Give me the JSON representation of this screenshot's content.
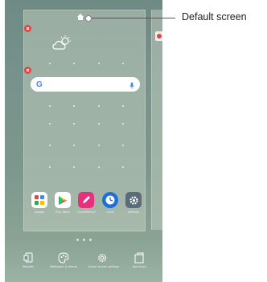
{
  "callout": {
    "label": "Default screen"
  },
  "search": {
    "logo": "G",
    "mic_icon": "mic-icon"
  },
  "weather": {
    "icon": "cloud-sun-icon"
  },
  "apps": [
    {
      "label": "Google",
      "icon": "google-folder-icon",
      "color": "#ffffff"
    },
    {
      "label": "Play Store",
      "icon": "play-store-icon",
      "color": "#ffffff"
    },
    {
      "label": "QuickMemo+",
      "icon": "quickmemo-icon",
      "color": "#e8317d"
    },
    {
      "label": "Clock",
      "icon": "clock-icon",
      "color": "#1e6fd9"
    },
    {
      "label": "Settings",
      "icon": "settings-icon",
      "color": "#5b6b78"
    }
  ],
  "tools": [
    {
      "label": "Widgets",
      "icon": "widgets-icon"
    },
    {
      "label": "Wallpaper & theme",
      "icon": "palette-icon"
    },
    {
      "label": "Home screen settings",
      "icon": "gear-icon"
    },
    {
      "label": "App trays",
      "icon": "app-tray-icon"
    }
  ],
  "colors": {
    "wallpaper": "#7c978d",
    "remove_badge": "#e04646",
    "accent": "#c2185b"
  }
}
